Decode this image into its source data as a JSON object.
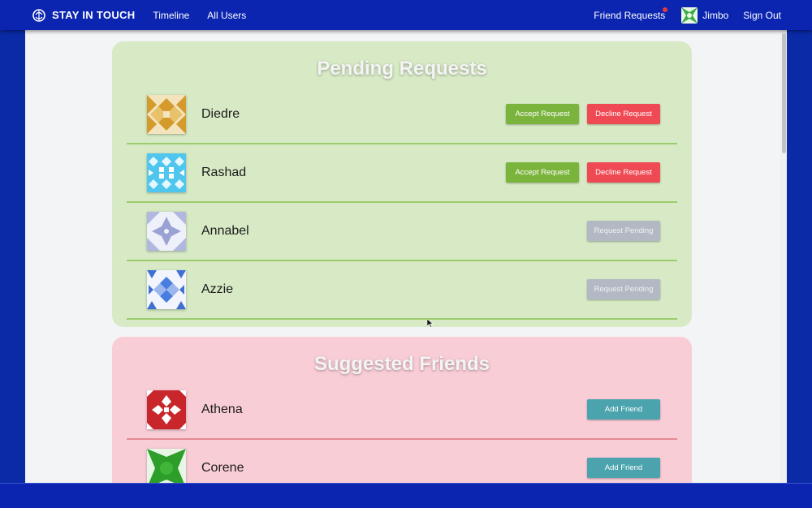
{
  "nav": {
    "brand": "STAY IN TOUCH",
    "links": [
      "Timeline",
      "All Users"
    ],
    "friend_requests": "Friend Requests",
    "user_name": "Jimbo",
    "sign_out": "Sign Out"
  },
  "pending": {
    "title": "Pending Requests",
    "rows": [
      {
        "name": "Diedre",
        "accept": "Accept Request",
        "decline": "Decline Request"
      },
      {
        "name": "Rashad",
        "accept": "Accept Request",
        "decline": "Decline Request"
      },
      {
        "name": "Annabel",
        "status": "Request Pending"
      },
      {
        "name": "Azzie",
        "status": "Request Pending"
      }
    ]
  },
  "suggested": {
    "title": "Suggested Friends",
    "rows": [
      {
        "name": "Athena",
        "action": "Add Friend"
      },
      {
        "name": "Corene",
        "action": "Add Friend"
      }
    ]
  },
  "colors": {
    "navbar": "#0b25b0",
    "pending_panel": "#d7eac5",
    "suggested_panel": "#f9cdd6",
    "accept": "#7bb43d",
    "decline": "#ef4a54",
    "pending_btn": "#b3b9c4",
    "add": "#4aa3ad"
  }
}
